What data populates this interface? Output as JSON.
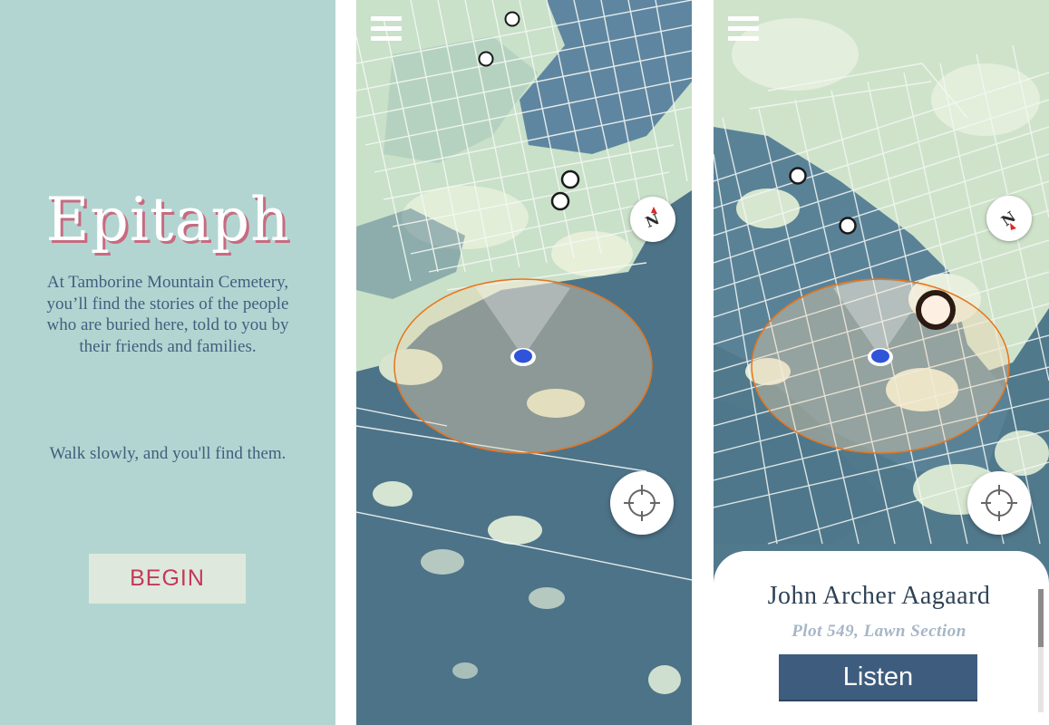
{
  "welcome": {
    "title": "Epitaph",
    "intro": "At Tamborine Mountain Cemetery, you’ll find the stories of the people who are buried here, told to you by their friends and families.",
    "walk_hint": "Walk slowly, and you'll find them.",
    "begin_label": "BEGIN"
  },
  "map": {
    "compass_label": "N",
    "colors": {
      "accent_orange": "#e8741a",
      "user_dot": "#2f54d9",
      "title_shadow": "#c76b80",
      "button_text": "#c4385a"
    }
  },
  "detail": {
    "name": "John Archer Aagaard",
    "plot": "Plot 549, Lawn Section",
    "listen_label": "Listen"
  },
  "icons": [
    "menu-icon",
    "compass-icon",
    "crosshair-icon"
  ]
}
